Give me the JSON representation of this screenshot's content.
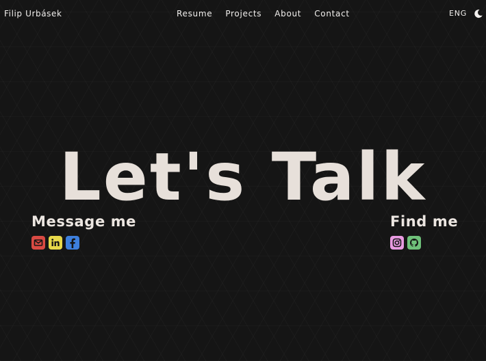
{
  "nav": {
    "brand": "Filip Urbásek",
    "links": [
      "Resume",
      "Projects",
      "About",
      "Contact"
    ],
    "language": "ENG",
    "theme_icon": "moon-icon"
  },
  "hero": {
    "title": "Let's Talk"
  },
  "message": {
    "title": "Message me",
    "icons": [
      {
        "name": "email-icon",
        "color": "#d94a43"
      },
      {
        "name": "linkedin-icon",
        "color": "#e8d94a"
      },
      {
        "name": "facebook-icon",
        "color": "#3d7fdc"
      }
    ]
  },
  "find": {
    "title": "Find me",
    "icons": [
      {
        "name": "instagram-icon",
        "color": "#e89ae0"
      },
      {
        "name": "github-icon",
        "color": "#6fc17a"
      }
    ]
  }
}
